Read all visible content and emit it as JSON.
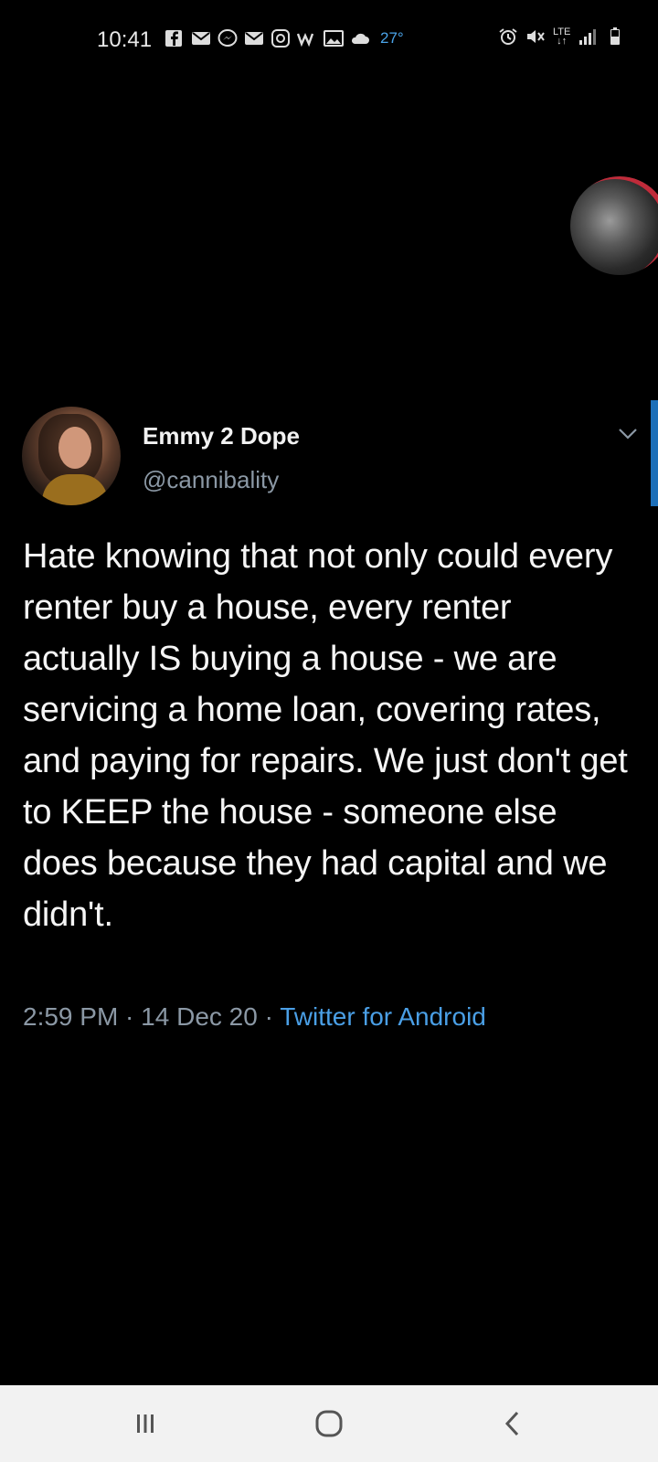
{
  "status_bar": {
    "time": "10:41",
    "temperature": "27°",
    "network": "LTE",
    "icons_left": [
      "facebook-icon",
      "mail-icon",
      "messenger-icon",
      "mail-icon",
      "instagram-icon",
      "webtoon-icon",
      "gallery-icon",
      "cloud-icon"
    ],
    "icons_right": [
      "alarm-icon",
      "mute-icon",
      "lte-icon",
      "signal-icon",
      "battery-icon"
    ]
  },
  "tweet": {
    "display_name": "Emmy 2 Dope",
    "handle": "@cannibality",
    "text": "Hate knowing that not only could every renter buy a house, every renter actually IS buying a house - we are servicing a home loan, covering rates, and paying for repairs. We just don't get to KEEP the house - someone else does because they had capital and we didn't.",
    "time": "2:59 PM",
    "separator": " · ",
    "date": "14 Dec 20",
    "source": "Twitter for Android"
  },
  "colors": {
    "background": "#000000",
    "link": "#4a9fe6",
    "secondary_text": "#8b98a5",
    "nav_bar": "#f2f2f2"
  },
  "nav_bar": {
    "buttons": [
      "recent-apps-icon",
      "home-icon",
      "back-icon"
    ]
  }
}
